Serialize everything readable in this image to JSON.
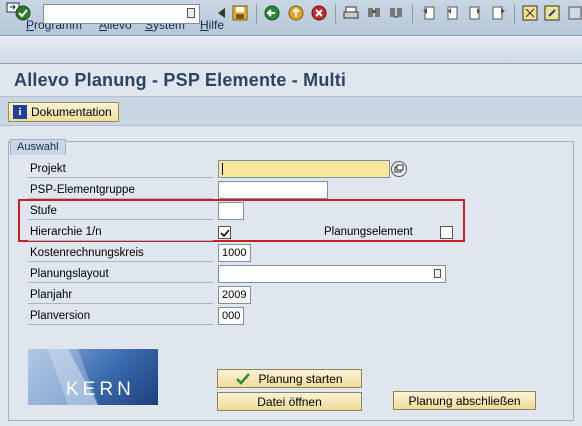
{
  "menu": {
    "items": [
      {
        "label": "Programm"
      },
      {
        "label": "Allevo"
      },
      {
        "label": "System"
      },
      {
        "label": "Hilfe"
      }
    ]
  },
  "toolbar": {
    "command_value": "",
    "icons": [
      "enter-icon",
      "dropdown-icon",
      "back-arrow-icon",
      "save-icon",
      "back-icon",
      "exit-icon",
      "cancel-icon",
      "print-icon",
      "find-icon",
      "find-next-icon",
      "first-page-icon",
      "prev-page-icon",
      "next-page-icon",
      "last-page-icon",
      "layout-icon",
      "help-icon"
    ]
  },
  "title": "Allevo Planung - PSP Elemente   - Multi",
  "doc_button": {
    "label": "Dokumentation",
    "icon": "info-icon"
  },
  "group": {
    "title": "Auswahl",
    "fields": {
      "projekt": {
        "label": "Projekt",
        "value": ""
      },
      "psp_gruppe": {
        "label": "PSP-Elementgruppe",
        "value": ""
      },
      "stufe": {
        "label": "Stufe",
        "value": ""
      },
      "hierarchie": {
        "label": "Hierarchie 1/n",
        "checked": true
      },
      "planungselement": {
        "label": "Planungselement",
        "checked": false
      },
      "kostenrechnungskreis": {
        "label": "Kostenrechnungskreis",
        "value": "1000"
      },
      "planungslayout": {
        "label": "Planungslayout",
        "value": ""
      },
      "planjahr": {
        "label": "Planjahr",
        "value": "2009"
      },
      "planversion": {
        "label": "Planversion",
        "value": "000"
      }
    }
  },
  "buttons": {
    "start": "Planung starten",
    "open": "Datei öffnen",
    "close": "Planung abschließen"
  },
  "logo": {
    "text": "KERN"
  },
  "colors": {
    "accent": "#2c4363",
    "highlight": "#c6202a",
    "button": "#efdc98",
    "required": "#fbe79a"
  }
}
